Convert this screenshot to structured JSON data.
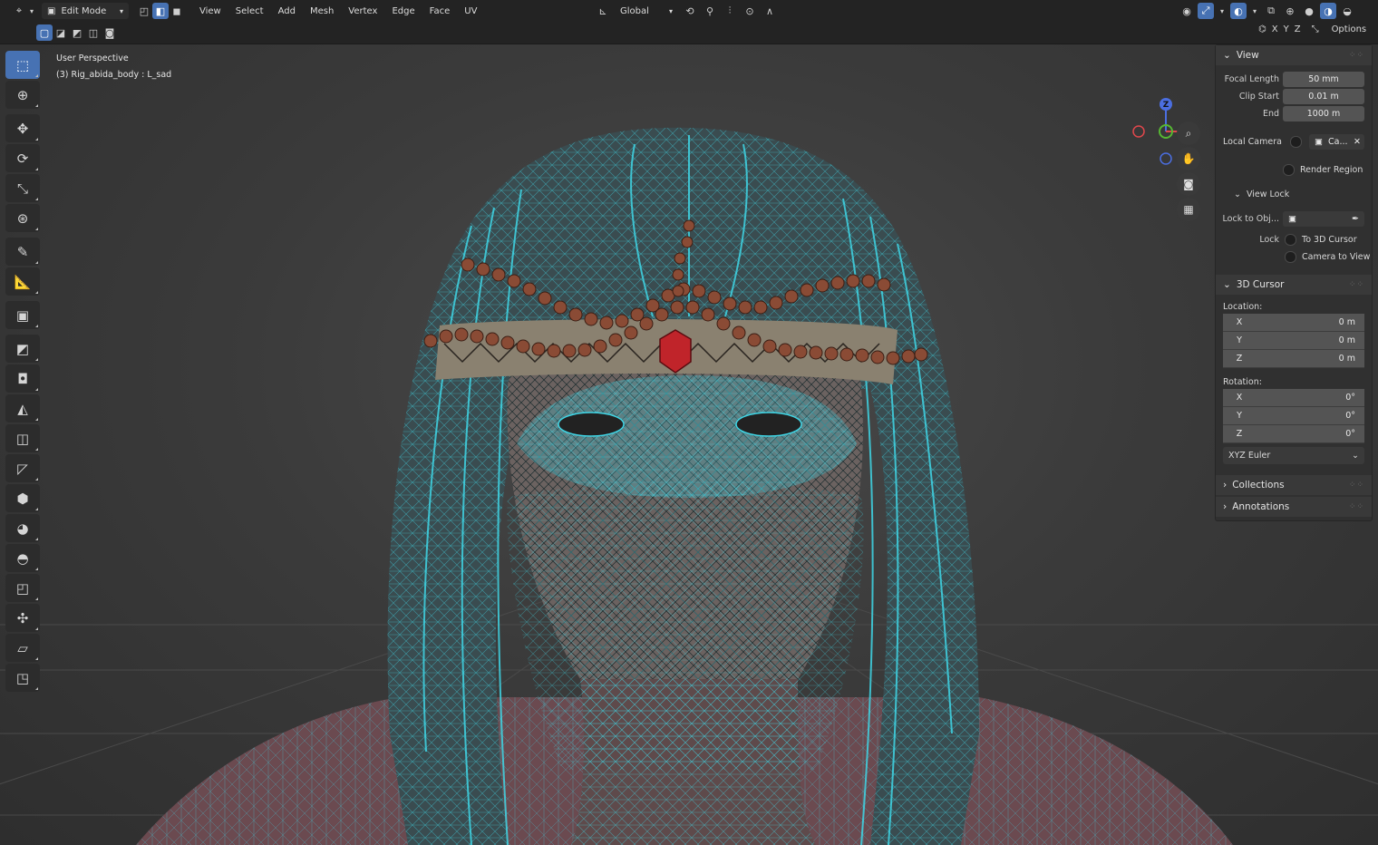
{
  "header": {
    "mode": "Edit Mode",
    "menus": [
      "View",
      "Select",
      "Add",
      "Mesh",
      "Vertex",
      "Edge",
      "Face",
      "UV"
    ],
    "transform_orientation": "Global",
    "mirror_axes": [
      "X",
      "Y",
      "Z"
    ],
    "options_label": "Options"
  },
  "viewport": {
    "perspective_label": "User Perspective",
    "object_label": "(3) Rig_abida_body : L_sad",
    "gizmo": {
      "z": "Z",
      "x": "X"
    }
  },
  "npanel": {
    "view_section": {
      "title": "View",
      "focal_length_label": "Focal Length",
      "focal_length_value": "50 mm",
      "clip_start_label": "Clip Start",
      "clip_start_value": "0.01 m",
      "end_label": "End",
      "end_value": "1000 m",
      "local_camera_label": "Local Camera",
      "local_camera_value": "Ca...",
      "render_region_label": "Render Region"
    },
    "view_lock": {
      "title": "View Lock",
      "lock_to_object_label": "Lock to Obj...",
      "lock_label": "Lock",
      "to_3d_cursor_label": "To 3D Cursor",
      "camera_to_view_label": "Camera to View"
    },
    "cursor_section": {
      "title": "3D Cursor",
      "location_label": "Location:",
      "location": [
        {
          "axis": "X",
          "value": "0 m"
        },
        {
          "axis": "Y",
          "value": "0 m"
        },
        {
          "axis": "Z",
          "value": "0 m"
        }
      ],
      "rotation_label": "Rotation:",
      "rotation": [
        {
          "axis": "X",
          "value": "0°"
        },
        {
          "axis": "Y",
          "value": "0°"
        },
        {
          "axis": "Z",
          "value": "0°"
        }
      ],
      "rotation_mode": "XYZ Euler"
    },
    "collections_title": "Collections",
    "annotations_title": "Annotations"
  },
  "colors": {
    "accent": "#4772b3",
    "wire": "#3fd6e6",
    "gizmo_x": "#e0474c",
    "gizmo_y": "#56b833",
    "gizmo_z": "#4b6ee0",
    "bead": "#8a4b35",
    "jewel": "#c0242a"
  }
}
